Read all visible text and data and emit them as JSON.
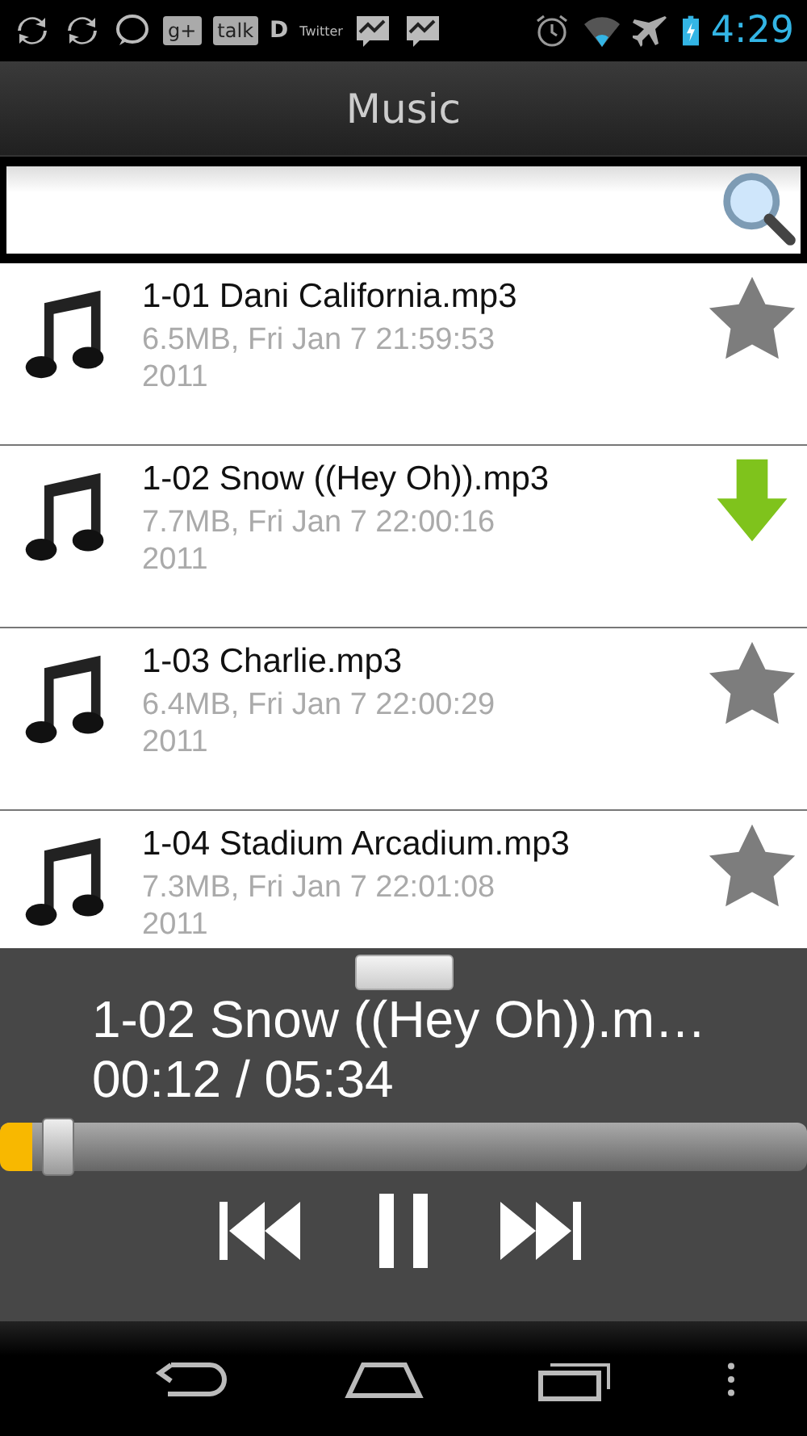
{
  "status_bar": {
    "notifications": [
      {
        "kind": "sync"
      },
      {
        "kind": "sync"
      },
      {
        "kind": "chat"
      },
      {
        "kind": "badge",
        "label": "g+"
      },
      {
        "kind": "badge",
        "label": "talk"
      },
      {
        "kind": "text",
        "label": "D"
      },
      {
        "kind": "small-text",
        "label": "Twitter"
      },
      {
        "kind": "chart"
      },
      {
        "kind": "chart"
      }
    ],
    "time": "4:29"
  },
  "title": "Music",
  "tracks": [
    {
      "title": "1-01 Dani California.mp3",
      "info": "6.5MB, Fri Jan  7 21:59:53 2011",
      "kind": "favorite"
    },
    {
      "title": "1-02 Snow ((Hey Oh)).mp3",
      "info": "7.7MB, Fri Jan  7 22:00:16 2011",
      "kind": "download"
    },
    {
      "title": "1-03 Charlie.mp3",
      "info": "6.4MB, Fri Jan  7 22:00:29 2011",
      "kind": "favorite"
    },
    {
      "title": "1-04 Stadium Arcadium.mp3",
      "info": "7.3MB, Fri Jan  7 22:01:08 2011",
      "kind": "favorite"
    }
  ],
  "player": {
    "title": "1-02 Snow ((Hey Oh)).m…",
    "time": "00:12 / 05:34",
    "level": 0.04,
    "playing": true
  }
}
